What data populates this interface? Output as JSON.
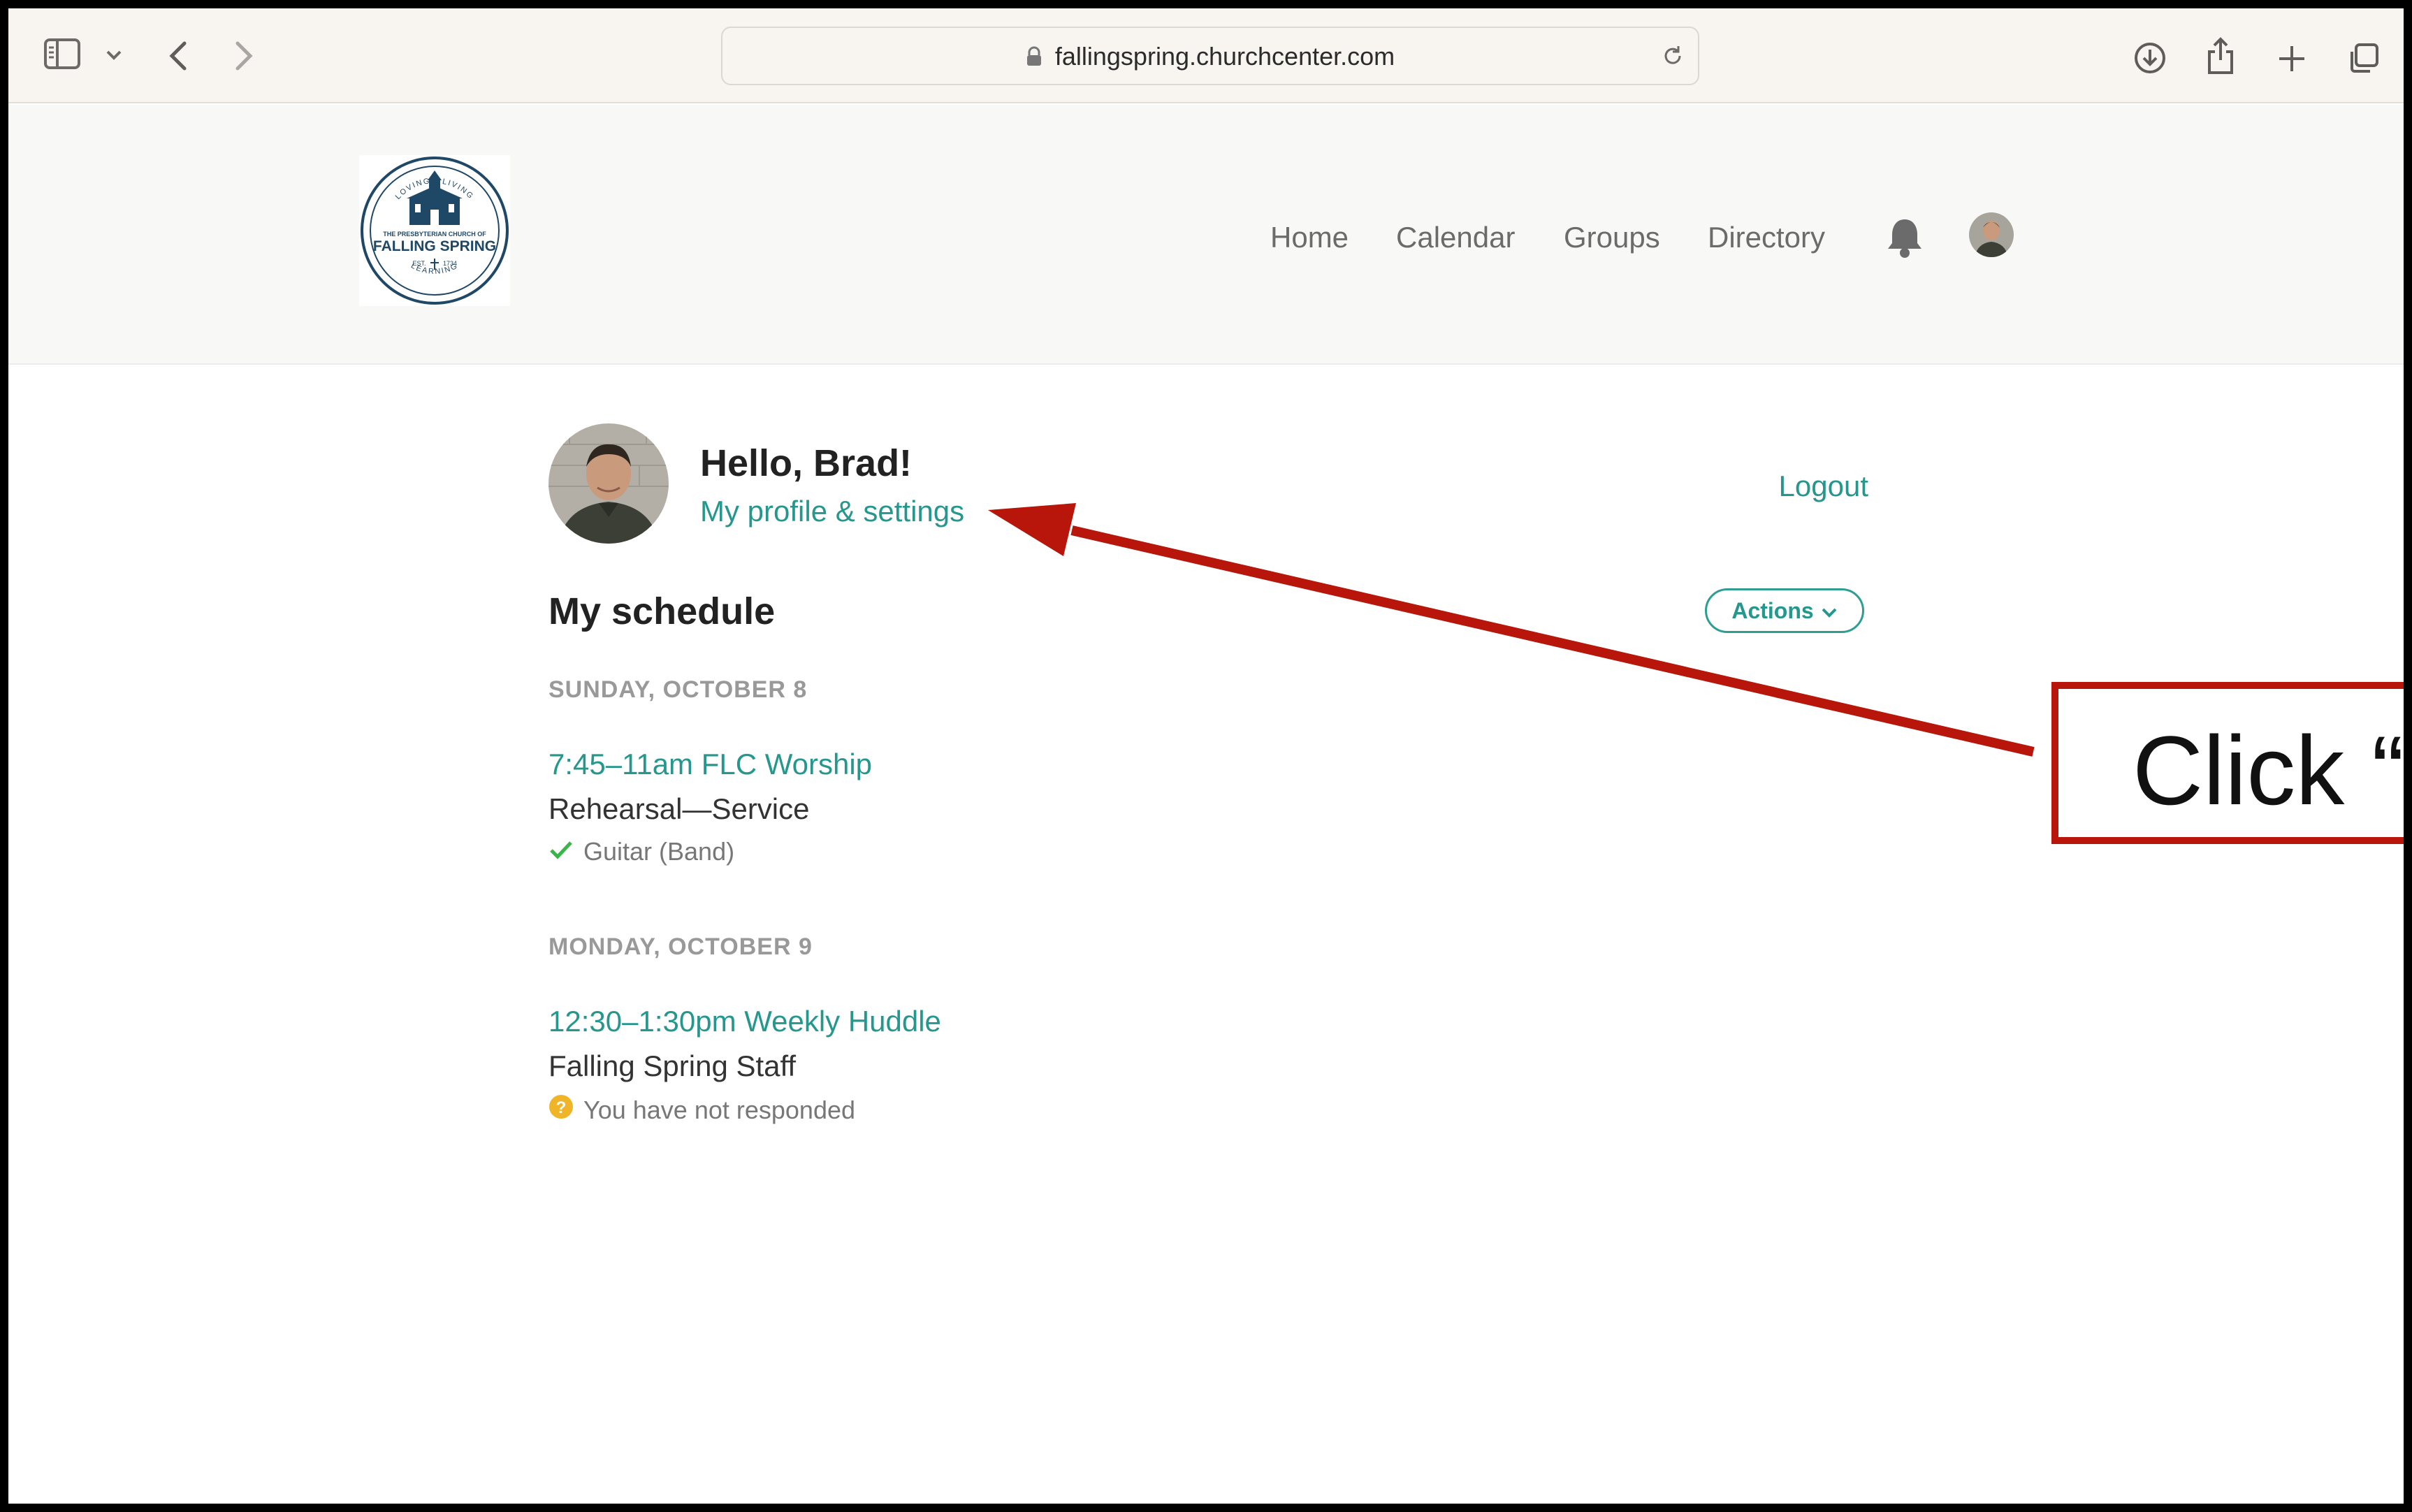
{
  "browser": {
    "url": "fallingspring.churchcenter.com",
    "icons": [
      "sidebar-icon",
      "chevron-down-icon",
      "back-icon",
      "forward-icon",
      "lock-icon",
      "reload-icon",
      "download-icon",
      "share-icon",
      "plus-icon",
      "tabs-icon"
    ]
  },
  "site": {
    "logo": {
      "top_ring": "LOVING · LIVING",
      "line1": "THE PRESBYTERIAN CHURCH OF",
      "line2": "FALLING SPRING",
      "est": "EST.",
      "year": "1734",
      "bottom_ring": "LEARNING"
    },
    "nav": [
      "Home",
      "Calendar",
      "Groups",
      "Directory"
    ]
  },
  "main": {
    "greeting": "Hello, Brad!",
    "profile_link": "My profile & settings",
    "logout": "Logout",
    "schedule_title": "My schedule",
    "actions_label": "Actions",
    "days": [
      {
        "label": "SUNDAY, OCTOBER 8",
        "event_link": "7:45–11am FLC Worship",
        "event_sub": "Rehearsal—Service",
        "status": "Guitar (Band)",
        "status_type": "confirmed"
      },
      {
        "label": "MONDAY, OCTOBER 9",
        "event_link": "12:30–1:30pm Weekly Huddle",
        "event_sub": "Falling Spring Staff",
        "status": "You have not responded",
        "status_type": "pending"
      }
    ]
  },
  "annotation": {
    "text": "Click “"
  },
  "colors": {
    "accent": "#25978d",
    "annotation_red": "#b8160a",
    "confirmed_green": "#3bb54a",
    "pending_yellow": "#f0b429",
    "logo_navy": "#1f4766"
  }
}
